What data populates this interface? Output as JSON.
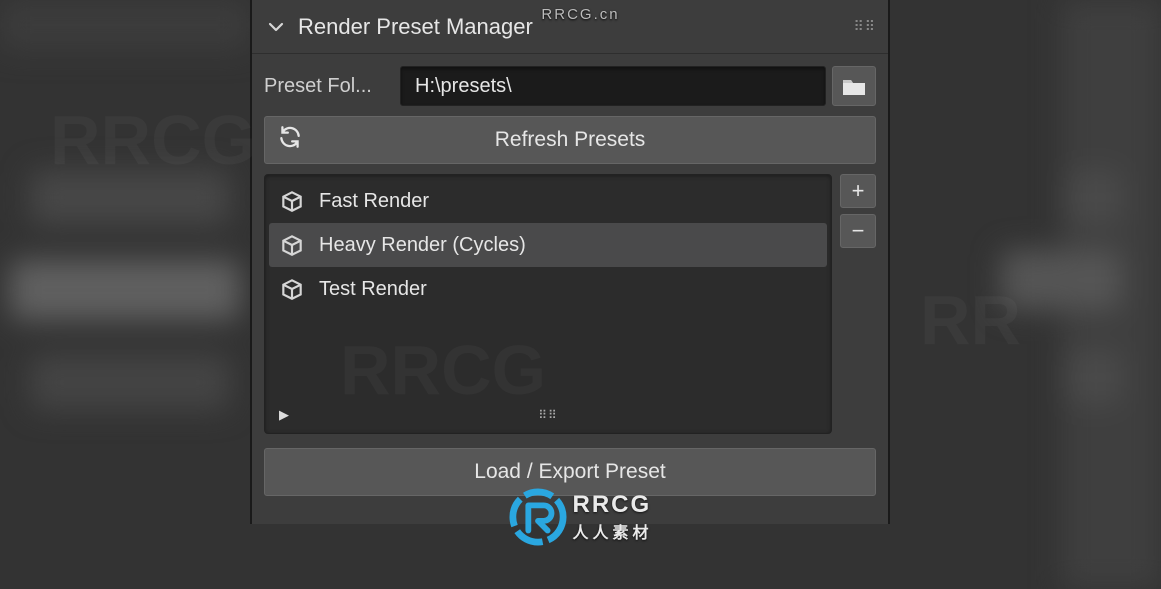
{
  "header": {
    "title": "Render Preset Manager"
  },
  "folder": {
    "label": "Preset Fol...",
    "path": "H:\\presets\\"
  },
  "refresh": {
    "label": "Refresh Presets"
  },
  "presets": [
    {
      "name": "Fast Render",
      "selected": false
    },
    {
      "name": "Heavy Render (Cycles)",
      "selected": true
    },
    {
      "name": "Test Render",
      "selected": false
    }
  ],
  "actions": {
    "add": "+",
    "remove": "−",
    "load": "Load / Export Preset"
  },
  "watermark": {
    "top": "RRCG.cn",
    "brand_en": "RRCG",
    "brand_cn": "人人素材"
  }
}
